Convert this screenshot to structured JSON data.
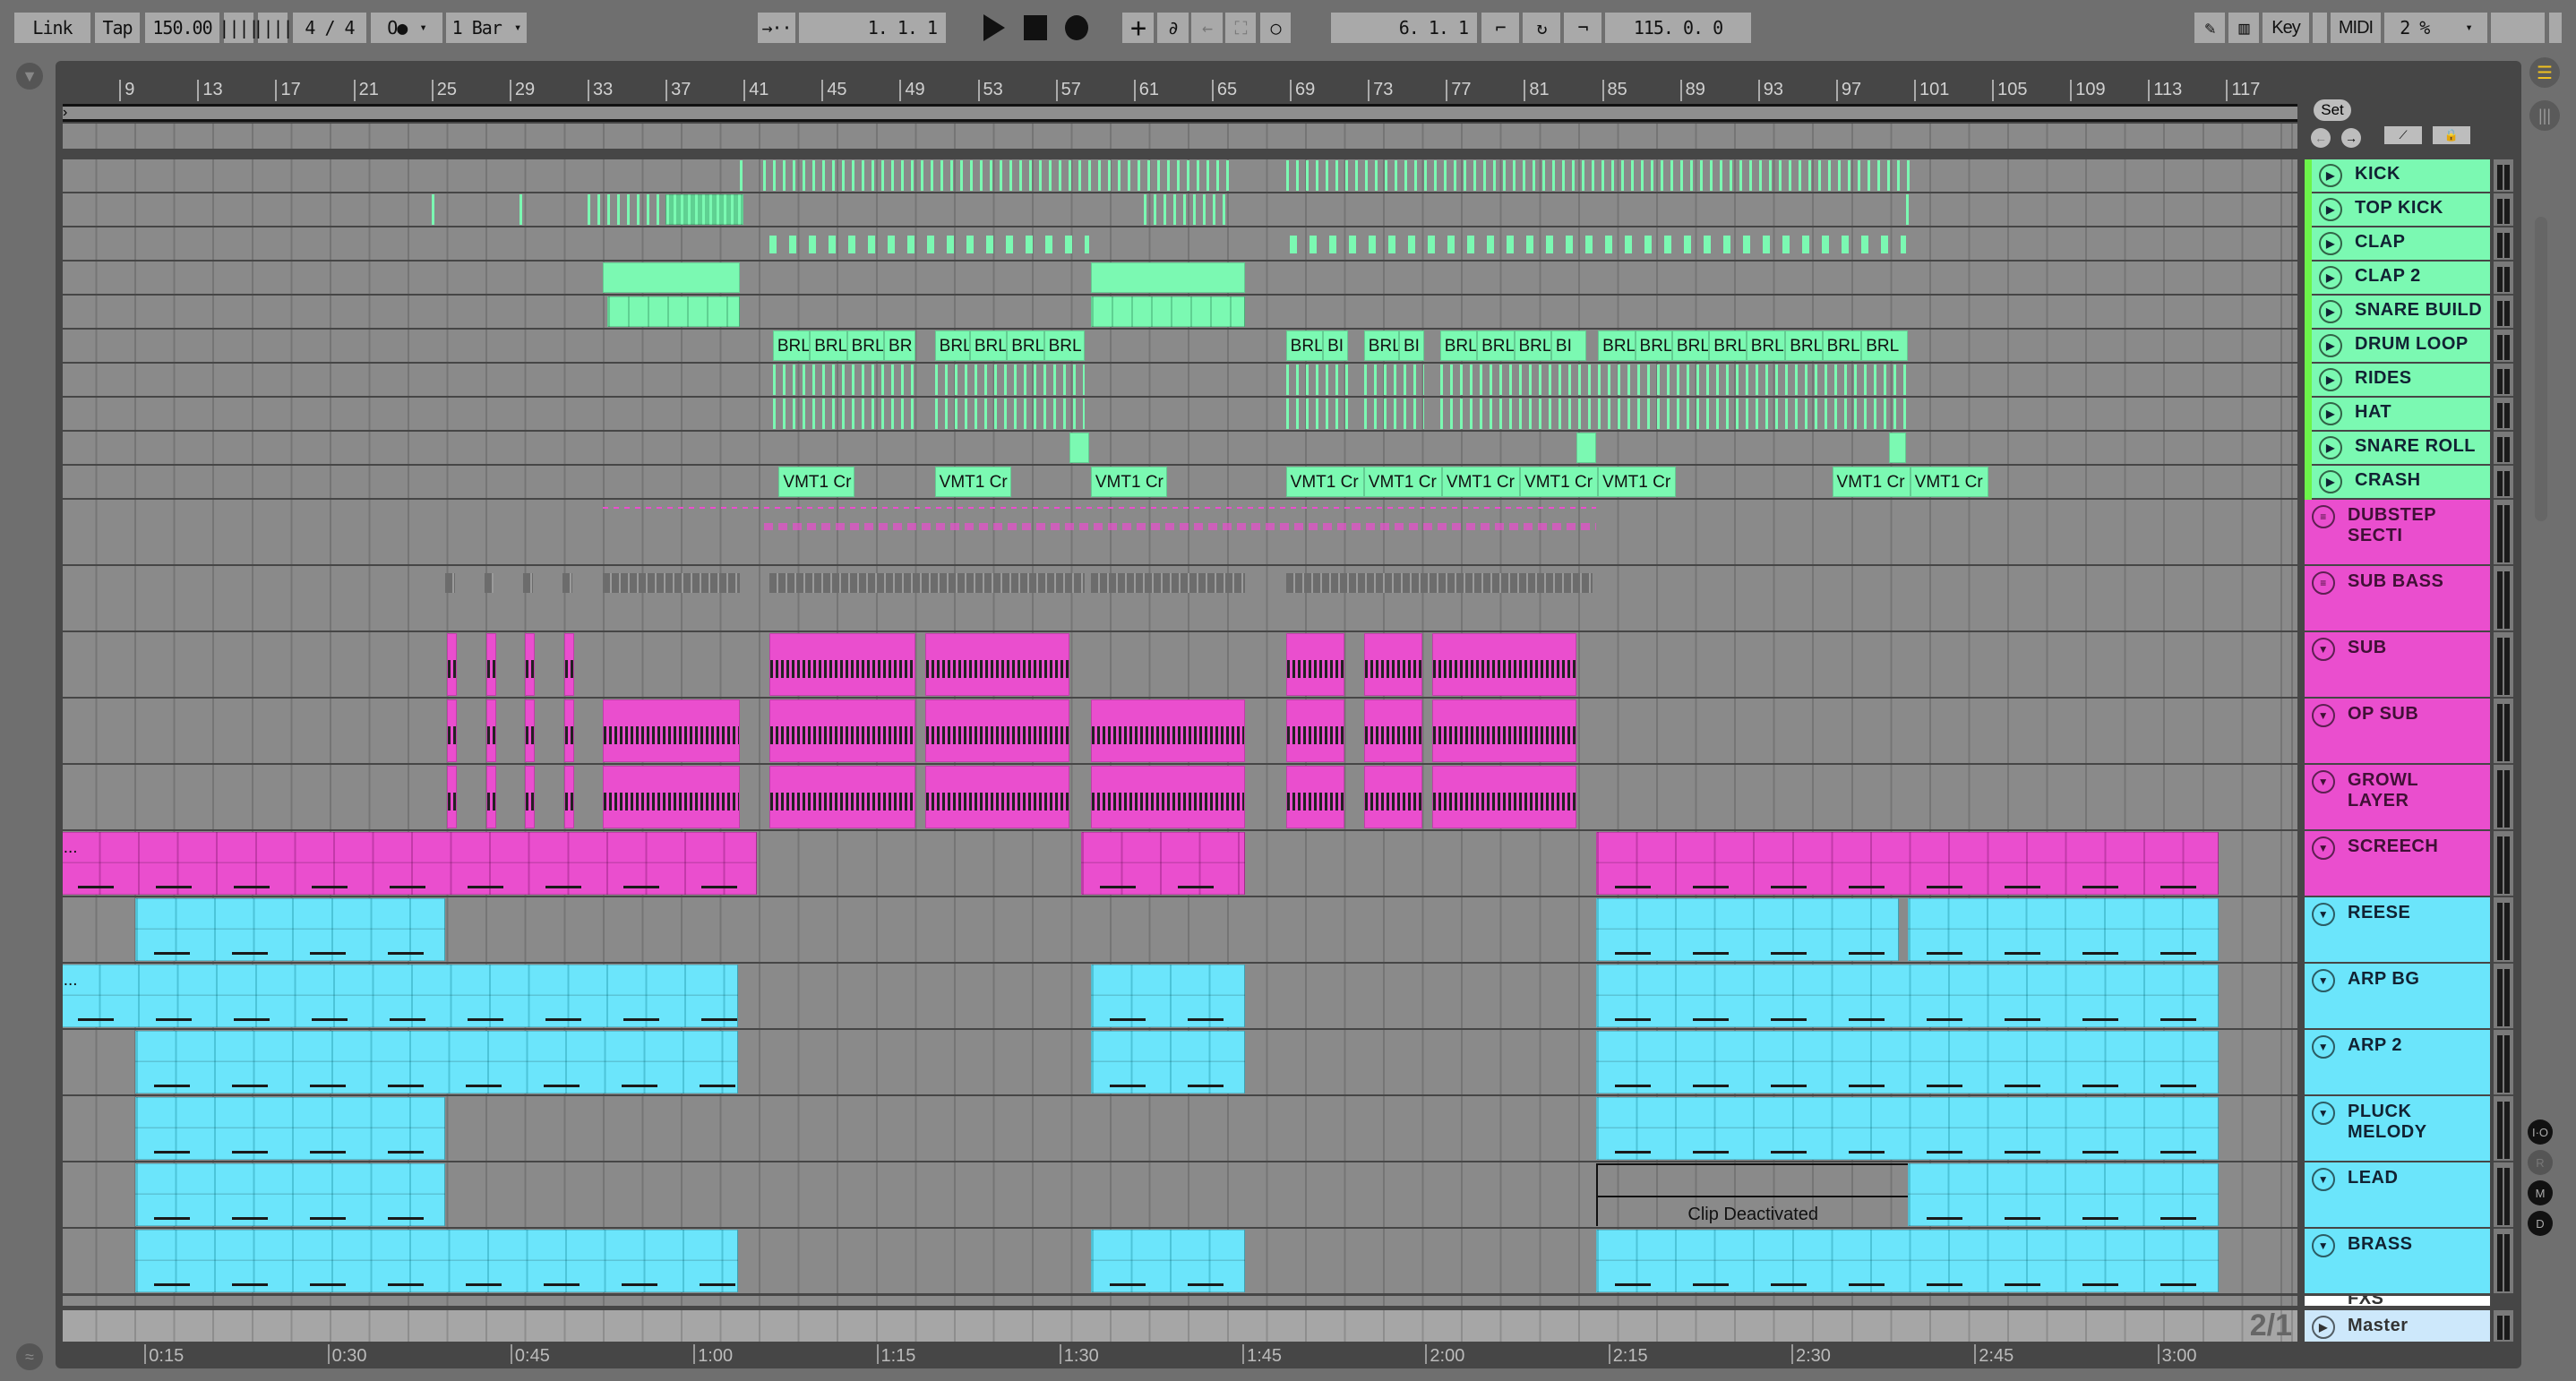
{
  "toolbar": {
    "link": "Link",
    "tap": "Tap",
    "tempo": "150.00",
    "nudge_down": "||||",
    "nudge_up": "||||",
    "signature": "4 / 4",
    "metronome": "O●",
    "metronome_arrow": "▾",
    "quantize": "1 Bar",
    "quantize_arrow": "▾",
    "follow": "→··",
    "position": "1.  1.  1",
    "loop_start": "6.  1.  1",
    "loop_length": "115.  0.  0",
    "key": "Key",
    "midi": "MIDI",
    "cpu": "2 %",
    "cpu_arrow": "▾"
  },
  "ruler": {
    "bars": [
      9,
      13,
      17,
      21,
      25,
      29,
      33,
      37,
      41,
      45,
      49,
      53,
      57,
      61,
      65,
      69,
      73,
      77,
      81,
      85,
      89,
      93,
      97,
      101,
      105,
      109,
      113,
      117
    ]
  },
  "time_ruler": {
    "labels": [
      "0:15",
      "0:30",
      "0:45",
      "1:00",
      "1:15",
      "1:30",
      "1:45",
      "2:00",
      "2:15",
      "2:30",
      "2:45",
      "3:00"
    ],
    "seconds": [
      15,
      30,
      45,
      60,
      75,
      90,
      105,
      120,
      135,
      150,
      165,
      180
    ]
  },
  "set_label": "Set",
  "page_indicator": "2/1",
  "master": "Master",
  "fxs": "FXS",
  "side_buttons": [
    "I·O",
    "R",
    "M",
    "D"
  ],
  "colors": {
    "green": "#7bf9b2",
    "magenta": "#ea4ece",
    "cyan": "#6be5fb",
    "master": "#cde8fb"
  },
  "deactivated_label": "Clip Deactivated",
  "tracks": [
    {
      "name": "KICK",
      "color": "green",
      "icon": "play",
      "size": "s",
      "clips": [
        [
          40.8,
          41.0,
          "",
          "stripes"
        ],
        [
          42,
          49.8,
          "",
          "stripes"
        ],
        [
          50.1,
          66,
          "",
          "stripes"
        ],
        [
          68.8,
          101,
          "",
          "stripes"
        ]
      ]
    },
    {
      "name": "TOP KICK",
      "color": "green",
      "icon": "play",
      "size": "s",
      "clips": [
        [
          25,
          25.3,
          "",
          "stripes"
        ],
        [
          29.5,
          29.7,
          "",
          "stripes"
        ],
        [
          33,
          37,
          "",
          "stripes"
        ],
        [
          37,
          41,
          "",
          "solidstripes"
        ],
        [
          61.5,
          66,
          "",
          "stripes"
        ],
        [
          100.6,
          101,
          "",
          "stripes"
        ]
      ]
    },
    {
      "name": "CLAP",
      "color": "green",
      "icon": "play",
      "size": "s",
      "clips": [
        [
          42.3,
          58.7,
          "",
          "wide"
        ],
        [
          69,
          100.6,
          "",
          "wide"
        ]
      ]
    },
    {
      "name": "CLAP 2",
      "color": "green",
      "icon": "play",
      "size": "s",
      "clips": [
        [
          33.8,
          40.8,
          "",
          "solid"
        ],
        [
          58.8,
          66.7,
          "",
          "solid"
        ]
      ]
    },
    {
      "name": "SNARE BUILD",
      "color": "green",
      "icon": "play",
      "size": "s",
      "clips": [
        [
          34,
          40.8,
          "",
          "segments"
        ],
        [
          58.8,
          66.7,
          "",
          "segments"
        ]
      ]
    },
    {
      "name": "DRUM LOOP",
      "color": "green",
      "icon": "play",
      "size": "s",
      "clips": [
        [
          42.5,
          44.4,
          "BRL",
          "solid"
        ],
        [
          44.4,
          46.3,
          "BRL",
          "solid"
        ],
        [
          46.3,
          48.2,
          "BRL",
          "solid"
        ],
        [
          48.2,
          49.8,
          "BR",
          "solid"
        ],
        [
          50.8,
          52.6,
          "BRL",
          "solid"
        ],
        [
          52.6,
          54.5,
          "BRL",
          "solid"
        ],
        [
          54.5,
          56.4,
          "BRL",
          "solid"
        ],
        [
          56.4,
          58.5,
          "BRL",
          "solid"
        ],
        [
          68.8,
          70.7,
          "BRL",
          "solid"
        ],
        [
          70.7,
          72,
          "BI",
          "solid"
        ],
        [
          72.8,
          74.6,
          "BRL",
          "solid"
        ],
        [
          74.6,
          75.9,
          "BI",
          "solid"
        ],
        [
          76.7,
          78.6,
          "BRL",
          "solid"
        ],
        [
          78.6,
          80.5,
          "BRL",
          "solid"
        ],
        [
          80.5,
          82.4,
          "BRL",
          "solid"
        ],
        [
          82.4,
          84.2,
          "BI",
          "solid"
        ],
        [
          84.8,
          86.7,
          "BRL",
          "solid"
        ],
        [
          86.7,
          88.6,
          "BRL",
          "solid"
        ],
        [
          88.6,
          90.5,
          "BRL",
          "solid"
        ],
        [
          90.5,
          92.4,
          "BRL",
          "solid"
        ],
        [
          92.4,
          94.4,
          "BRL",
          "solid"
        ],
        [
          94.4,
          96.3,
          "BRL",
          "solid"
        ],
        [
          96.3,
          98.3,
          "BRL",
          "solid"
        ],
        [
          98.3,
          100.7,
          "BRL",
          "solid"
        ]
      ]
    },
    {
      "name": "RIDES",
      "color": "green",
      "icon": "play",
      "size": "s",
      "clips": [
        [
          42.5,
          49.8,
          "",
          "stripes"
        ],
        [
          50.8,
          58.5,
          "",
          "stripes"
        ],
        [
          68.8,
          72,
          "",
          "stripes"
        ],
        [
          72.8,
          75.9,
          "",
          "stripes"
        ],
        [
          76.7,
          84.5,
          "",
          "stripes"
        ],
        [
          84.8,
          100.7,
          "",
          "stripes"
        ]
      ]
    },
    {
      "name": "HAT",
      "color": "green",
      "icon": "play",
      "size": "s",
      "clips": [
        [
          42.5,
          49.8,
          "",
          "stripes"
        ],
        [
          50.8,
          58.5,
          "",
          "stripes"
        ],
        [
          68.8,
          72,
          "",
          "stripes"
        ],
        [
          72.8,
          75.9,
          "",
          "stripes"
        ],
        [
          76.7,
          84.5,
          "",
          "stripes"
        ],
        [
          84.8,
          100.7,
          "",
          "stripes"
        ]
      ]
    },
    {
      "name": "SNARE ROLL",
      "color": "green",
      "icon": "play",
      "size": "s",
      "clips": [
        [
          57.7,
          58.7,
          "",
          "solid"
        ],
        [
          83.7,
          84.7,
          "",
          "solid"
        ],
        [
          99.7,
          100.6,
          "",
          "solid"
        ]
      ]
    },
    {
      "name": "CRASH",
      "color": "green",
      "icon": "play",
      "size": "s",
      "clips": [
        [
          42.8,
          46.7,
          "VMT1 Cr",
          "solid"
        ],
        [
          50.8,
          54.7,
          "VMT1 Cr",
          "solid"
        ],
        [
          58.8,
          62.7,
          "VMT1 Cr",
          "solid"
        ],
        [
          68.8,
          72.8,
          "VMT1 Cr",
          "solid"
        ],
        [
          72.8,
          76.8,
          "VMT1 Cr",
          "solid"
        ],
        [
          76.8,
          80.8,
          "VMT1 Cr",
          "solid"
        ],
        [
          80.8,
          84.8,
          "VMT1 Cr",
          "solid"
        ],
        [
          84.8,
          88.8,
          "VMT1 Cr",
          "solid"
        ],
        [
          96.8,
          100.8,
          "VMT1 Cr",
          "solid"
        ],
        [
          100.8,
          104.8,
          "VMT1 Cr",
          "solid"
        ]
      ]
    },
    {
      "name": "DUBSTEP SECTI",
      "color": "magenta",
      "icon": "group",
      "size": "l",
      "clips": [
        [
          33.8,
          84.7,
          "",
          "groupline"
        ]
      ]
    },
    {
      "name": "SUB BASS",
      "color": "magenta",
      "icon": "group",
      "size": "l",
      "clips": [
        [
          25.7,
          26.2,
          "",
          "grey"
        ],
        [
          27.7,
          28.2,
          "",
          "grey"
        ],
        [
          29.7,
          30.2,
          "",
          "grey"
        ],
        [
          31.7,
          32.2,
          "",
          "grey"
        ],
        [
          33.8,
          40.8,
          "",
          "grey"
        ],
        [
          42.3,
          58.5,
          "",
          "grey"
        ],
        [
          58.8,
          66.7,
          "",
          "grey"
        ],
        [
          68.8,
          84.5,
          "",
          "grey"
        ]
      ]
    },
    {
      "name": "SUB",
      "color": "magenta",
      "icon": "fold",
      "size": "l",
      "clips": [
        [
          25.8,
          26.3,
          "",
          "dense"
        ],
        [
          27.8,
          28.3,
          "",
          "dense"
        ],
        [
          29.8,
          30.3,
          "",
          "dense"
        ],
        [
          31.8,
          32.3,
          "",
          "dense"
        ],
        [
          42.3,
          49.8,
          "",
          "dense"
        ],
        [
          50.3,
          57.7,
          "",
          "dense"
        ],
        [
          68.8,
          71.8,
          "",
          "dense"
        ],
        [
          72.8,
          75.8,
          "",
          "dense"
        ],
        [
          76.3,
          83.7,
          "",
          "dense"
        ]
      ]
    },
    {
      "name": "OP SUB",
      "color": "magenta",
      "icon": "fold",
      "size": "l",
      "clips": [
        [
          25.8,
          26.3,
          "",
          "dense"
        ],
        [
          27.8,
          28.3,
          "",
          "dense"
        ],
        [
          29.8,
          30.3,
          "",
          "dense"
        ],
        [
          31.8,
          32.3,
          "",
          "dense"
        ],
        [
          33.8,
          40.8,
          "",
          "dense"
        ],
        [
          42.3,
          49.8,
          "",
          "dense"
        ],
        [
          50.3,
          57.7,
          "",
          "dense"
        ],
        [
          58.8,
          66.7,
          "",
          "dense"
        ],
        [
          68.8,
          71.8,
          "",
          "dense"
        ],
        [
          72.8,
          75.8,
          "",
          "dense"
        ],
        [
          76.3,
          83.7,
          "",
          "dense"
        ]
      ]
    },
    {
      "name": "GROWL LAYER",
      "color": "magenta",
      "icon": "fold",
      "size": "l",
      "clips": [
        [
          25.8,
          26.3,
          "",
          "dense"
        ],
        [
          27.8,
          28.3,
          "",
          "dense"
        ],
        [
          29.8,
          30.3,
          "",
          "dense"
        ],
        [
          31.8,
          32.3,
          "",
          "dense"
        ],
        [
          33.8,
          40.8,
          "",
          "dense"
        ],
        [
          42.3,
          49.8,
          "",
          "dense"
        ],
        [
          50.3,
          57.7,
          "",
          "dense"
        ],
        [
          58.8,
          66.7,
          "",
          "dense"
        ],
        [
          68.8,
          71.8,
          "",
          "dense"
        ],
        [
          72.8,
          75.8,
          "",
          "dense"
        ],
        [
          76.3,
          83.7,
          "",
          "dense"
        ]
      ]
    },
    {
      "name": "SCREECH",
      "color": "magenta",
      "icon": "fold",
      "size": "l",
      "clips": [
        [
          5.9,
          41.7,
          "...",
          "notes"
        ],
        [
          58.3,
          66.7,
          "",
          "notes"
        ],
        [
          84.7,
          116.6,
          "",
          "notes"
        ]
      ]
    },
    {
      "name": "REESE",
      "color": "cyan",
      "icon": "fold",
      "size": "l",
      "clips": [
        [
          9.8,
          25.7,
          "",
          "notes"
        ],
        [
          84.7,
          100.2,
          "",
          "notes"
        ],
        [
          100.7,
          116.6,
          "",
          "notes"
        ]
      ]
    },
    {
      "name": "ARP BG",
      "color": "cyan",
      "icon": "fold",
      "size": "l",
      "clips": [
        [
          5.9,
          40.7,
          "...",
          "notes"
        ],
        [
          58.8,
          66.7,
          "",
          "notes"
        ],
        [
          84.7,
          116.6,
          "",
          "notes"
        ]
      ]
    },
    {
      "name": "ARP 2",
      "color": "cyan",
      "icon": "fold",
      "size": "l",
      "clips": [
        [
          9.8,
          40.7,
          "",
          "notes"
        ],
        [
          58.8,
          66.7,
          "",
          "notes"
        ],
        [
          84.7,
          116.6,
          "",
          "notes"
        ]
      ]
    },
    {
      "name": "PLUCK MELODY",
      "color": "cyan",
      "icon": "fold",
      "size": "l",
      "clips": [
        [
          9.8,
          25.7,
          "",
          "notes"
        ],
        [
          84.7,
          116.6,
          "",
          "notes"
        ]
      ]
    },
    {
      "name": "LEAD",
      "color": "cyan",
      "icon": "fold",
      "size": "l",
      "clips": [
        [
          9.8,
          25.7,
          "",
          "notes"
        ],
        [
          84.7,
          100.7,
          "Clip Deactivated",
          "deactivated"
        ],
        [
          100.7,
          116.6,
          "",
          "notes"
        ]
      ]
    },
    {
      "name": "BRASS",
      "color": "cyan",
      "icon": "fold",
      "size": "l",
      "clips": [
        [
          9.8,
          40.7,
          "",
          "notes"
        ],
        [
          58.8,
          66.7,
          "",
          "notes"
        ],
        [
          84.7,
          116.6,
          "",
          "notes"
        ]
      ]
    }
  ]
}
